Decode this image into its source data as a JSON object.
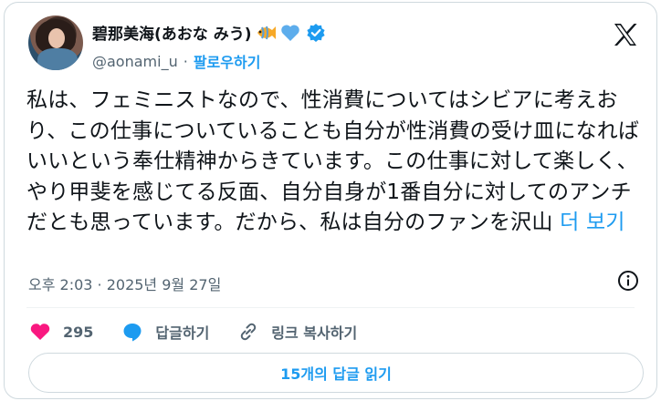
{
  "author": {
    "display_name": "碧那美海(あおな みう)",
    "handle": "@aonami_u",
    "separator": "·",
    "follow_label": "팔로우하기"
  },
  "tweet": {
    "text": "私は、フェミニストなので、性消費についてはシビアに考えおり、この仕事についていることも自分が性消費の受け皿になればいいという奉仕精神からきています。この仕事に対して楽しく、やり甲斐を感じてる反面、自分自身が1番自分に対してのアンチだとも思っています。だから、私は自分のファンを沢山",
    "more_label": " 더 보기",
    "timestamp": "오후 2:03 · 2025년 9월 27일"
  },
  "actions": {
    "like_count": "295",
    "reply_label": "답글하기",
    "copy_link_label": "링크 복사하기"
  },
  "read_replies_label": "15개의 답글 읽기",
  "colors": {
    "accent": "#1d9bf0",
    "like": "#f91880",
    "secondary_text": "#536471",
    "border": "#cfd9de"
  },
  "icons": [
    "fish-emoji-icon",
    "blue-heart-emoji-icon",
    "verified-badge-icon",
    "x-logo-icon",
    "info-icon",
    "heart-icon",
    "reply-bubble-icon",
    "link-icon"
  ]
}
